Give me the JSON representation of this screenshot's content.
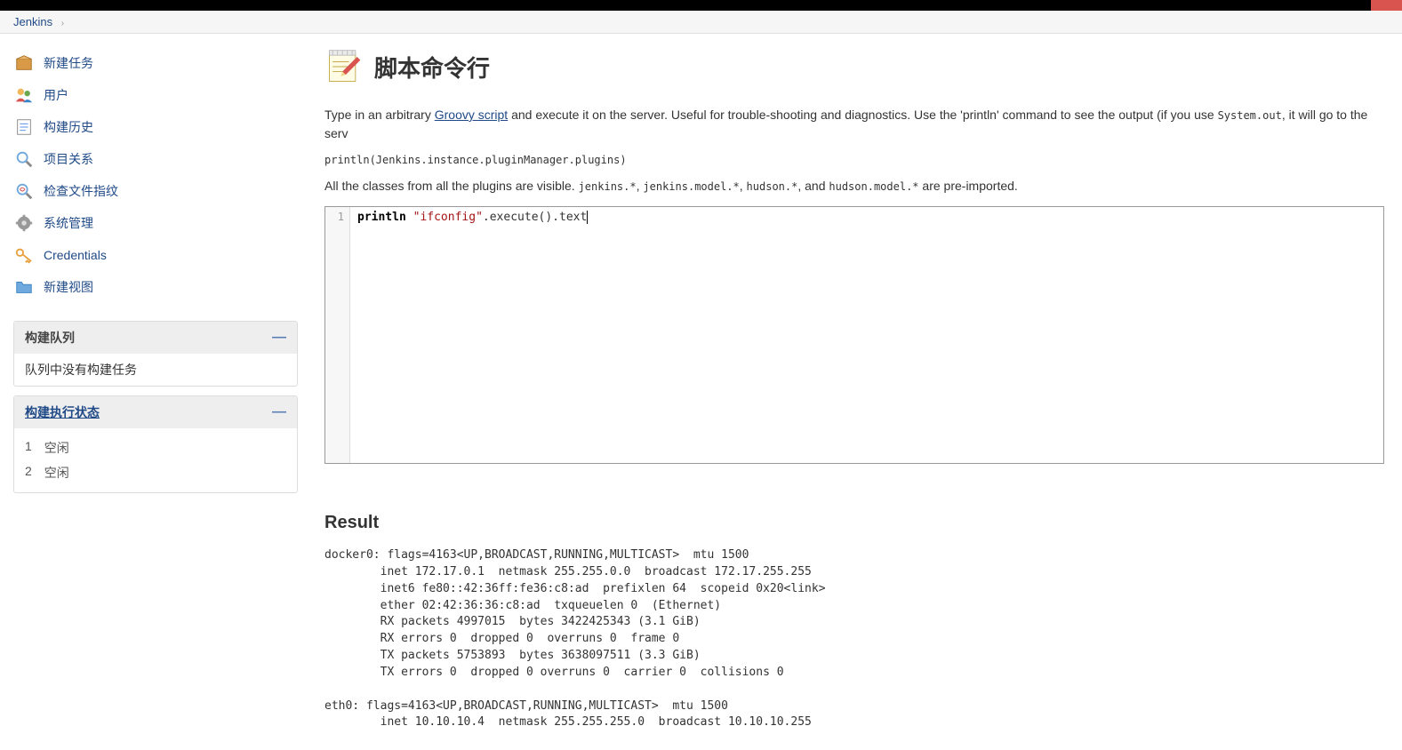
{
  "header": {
    "app_name": "Jenkins"
  },
  "breadcrumb": {
    "items": [
      "Jenkins"
    ]
  },
  "sidebar": {
    "menu": [
      {
        "name": "new-item",
        "label": "新建任务",
        "icon": "package"
      },
      {
        "name": "people",
        "label": "用户",
        "icon": "people"
      },
      {
        "name": "build-history",
        "label": "构建历史",
        "icon": "notepad"
      },
      {
        "name": "project-relationship",
        "label": "项目关系",
        "icon": "search"
      },
      {
        "name": "check-fingerprint",
        "label": "检查文件指纹",
        "icon": "fingerprint"
      },
      {
        "name": "manage",
        "label": "系统管理",
        "icon": "gear"
      },
      {
        "name": "credentials",
        "label": "Credentials",
        "icon": "keys"
      },
      {
        "name": "new-view",
        "label": "新建视图",
        "icon": "folder-plus"
      }
    ],
    "build_queue": {
      "title": "构建队列",
      "empty_text": "队列中没有构建任务"
    },
    "executors": {
      "title": "构建执行状态",
      "rows": [
        {
          "num": "1",
          "status": "空闲"
        },
        {
          "num": "2",
          "status": "空闲"
        }
      ]
    }
  },
  "main": {
    "title": "脚本命令行",
    "intro": {
      "prefix": "Type in an arbitrary ",
      "link_text": "Groovy script",
      "mid": " and execute it on the server. Useful for trouble-shooting and diagnostics. Use the 'println' command to see the output (if you use ",
      "code1": "System.out",
      "suffix": ", it will go to the serv"
    },
    "example": "println(Jenkins.instance.pluginManager.plugins)",
    "intro2": {
      "prefix": "All the classes from all the plugins are visible. ",
      "code1": "jenkins.*",
      "sep1": ", ",
      "code2": "jenkins.model.*",
      "sep2": ", ",
      "code3": "hudson.*",
      "sep3": ", and ",
      "code4": "hudson.model.*",
      "suffix": " are pre-imported."
    },
    "editor": {
      "line_number": "1",
      "code_kw": "println",
      "code_str": "\"ifconfig\"",
      "code_rest": ".execute().text"
    },
    "result": {
      "title": "Result",
      "output": "docker0: flags=4163<UP,BROADCAST,RUNNING,MULTICAST>  mtu 1500\n        inet 172.17.0.1  netmask 255.255.0.0  broadcast 172.17.255.255\n        inet6 fe80::42:36ff:fe36:c8:ad  prefixlen 64  scopeid 0x20<link>\n        ether 02:42:36:36:c8:ad  txqueuelen 0  (Ethernet)\n        RX packets 4997015  bytes 3422425343 (3.1 GiB)\n        RX errors 0  dropped 0  overruns 0  frame 0\n        TX packets 5753893  bytes 3638097511 (3.3 GiB)\n        TX errors 0  dropped 0 overruns 0  carrier 0  collisions 0\n\neth0: flags=4163<UP,BROADCAST,RUNNING,MULTICAST>  mtu 1500\n        inet 10.10.10.4  netmask 255.255.255.0  broadcast 10.10.10.255"
    }
  }
}
